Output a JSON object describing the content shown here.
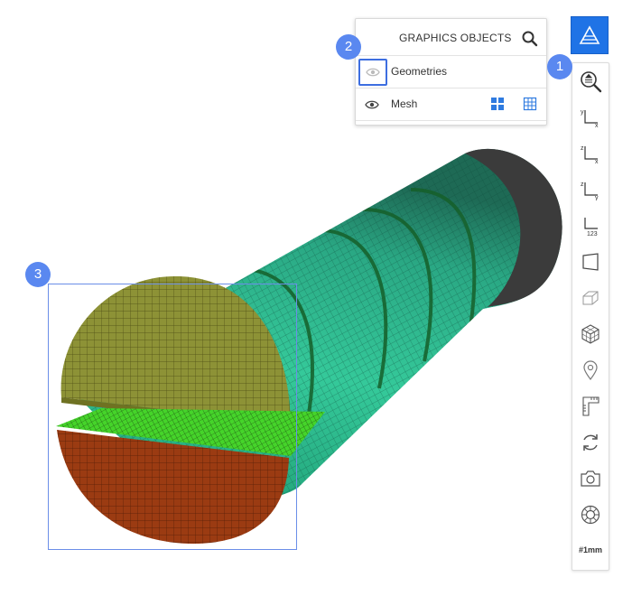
{
  "panel": {
    "title": "GRAPHICS OBJECTS",
    "search_icon": "search-icon",
    "rows": [
      {
        "label": "Geometries",
        "visible": false,
        "selected": true
      },
      {
        "label": "Mesh",
        "visible": true,
        "actions": [
          "mesh-solid-view-icon",
          "mesh-grid-view-icon"
        ]
      }
    ]
  },
  "toolbar": {
    "top_button_icon": "view-triangle-icon",
    "items": [
      "zoom-fit-icon",
      "axis-yx-icon",
      "axis-zx-icon",
      "axis-zy-icon",
      "axis-123-icon",
      "perspective-icon",
      "box-view-icon",
      "cube-mesh-icon",
      "location-pin-icon",
      "ruler-icon",
      "rotate-icon",
      "camera-icon",
      "settings-wheel-icon"
    ],
    "unit_label": "#1mm"
  },
  "callouts": [
    "1",
    "2",
    "3"
  ],
  "colors": {
    "accent": "#1f73e6",
    "badge": "#5a88f0",
    "mesh_teal": "#2ec28f",
    "mesh_olive": "#8c8f34",
    "mesh_brown": "#9a3a12",
    "mesh_green": "#3ecf2c"
  }
}
